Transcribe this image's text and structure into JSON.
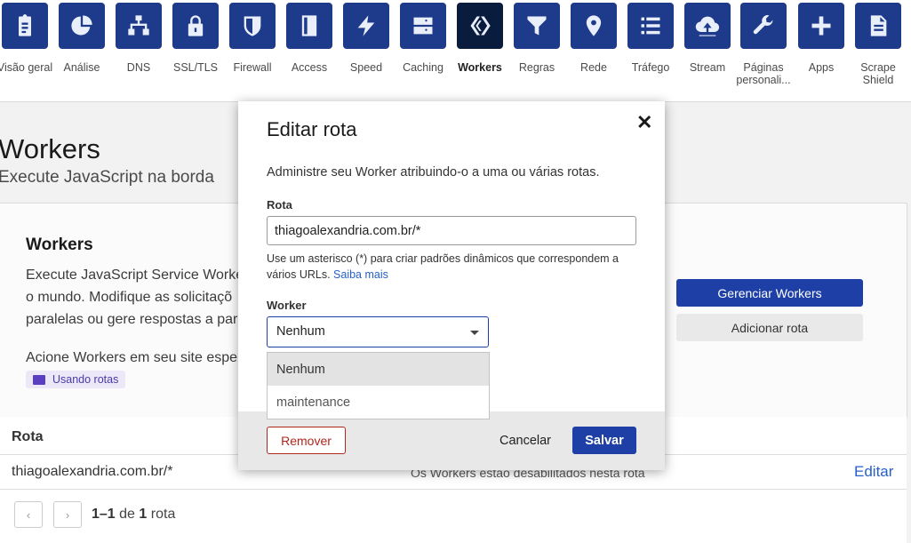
{
  "nav": {
    "items": [
      {
        "label": "Visão geral",
        "icon": "clipboard-icon"
      },
      {
        "label": "Análise",
        "icon": "pie-chart-icon"
      },
      {
        "label": "DNS",
        "icon": "network-icon"
      },
      {
        "label": "SSL/TLS",
        "icon": "lock-icon"
      },
      {
        "label": "Firewall",
        "icon": "shield-icon"
      },
      {
        "label": "Access",
        "icon": "door-icon"
      },
      {
        "label": "Speed",
        "icon": "lightning-icon"
      },
      {
        "label": "Caching",
        "icon": "server-icon"
      },
      {
        "label": "Workers",
        "icon": "workers-icon"
      },
      {
        "label": "Regras",
        "icon": "filter-icon"
      },
      {
        "label": "Rede",
        "icon": "location-pin-icon"
      },
      {
        "label": "Tráfego",
        "icon": "list-icon"
      },
      {
        "label": "Stream",
        "icon": "cloud-upload-icon"
      },
      {
        "label": "Páginas personali...",
        "icon": "wrench-icon"
      },
      {
        "label": "Apps",
        "icon": "plus-icon"
      },
      {
        "label": "Scrape Shield",
        "icon": "document-icon"
      }
    ],
    "active": "Workers"
  },
  "page": {
    "title": "Workers",
    "subtitle": "Execute JavaScript na borda",
    "card": {
      "title": "Workers",
      "desc_line1": "Execute JavaScript Service Worke",
      "desc_line2": "o mundo. Modifique as solicitaçõ",
      "desc_line3": "paralelas ou gere respostas a par",
      "trigger": "Acione Workers em seu site espe",
      "tag": "Usando rotas",
      "manage_button": "Gerenciar Workers",
      "add_route_button": "Adicionar rota"
    },
    "table": {
      "header": "Rota",
      "rows": [
        {
          "route": "thiagoalexandria.com.br/*",
          "status": "Os Workers estão desabilitados nesta rota",
          "action": "Editar"
        }
      ],
      "pager_range": "1–1",
      "pager_of": "de",
      "pager_total": "1",
      "pager_unit": "rota"
    }
  },
  "modal": {
    "title": "Editar rota",
    "intro": "Administre seu Worker atribuindo-o a uma ou várias rotas.",
    "route_label": "Rota",
    "route_value": "thiagoalexandria.com.br/*",
    "help_text": "Use um asterisco (*) para criar padrões dinâmicos que correspondem a vários URLs.",
    "help_link": "Saiba mais",
    "worker_label": "Worker",
    "worker_selected": "Nenhum",
    "worker_options": [
      "Nenhum",
      "maintenance"
    ],
    "remove_button": "Remover",
    "cancel_button": "Cancelar",
    "save_button": "Salvar",
    "close_glyph": "✕"
  },
  "colors": {
    "brand_blue": "#1e40a6",
    "nav_icon_bg": "#1e3a8a",
    "danger": "#b3261e",
    "link": "#2860c7"
  }
}
